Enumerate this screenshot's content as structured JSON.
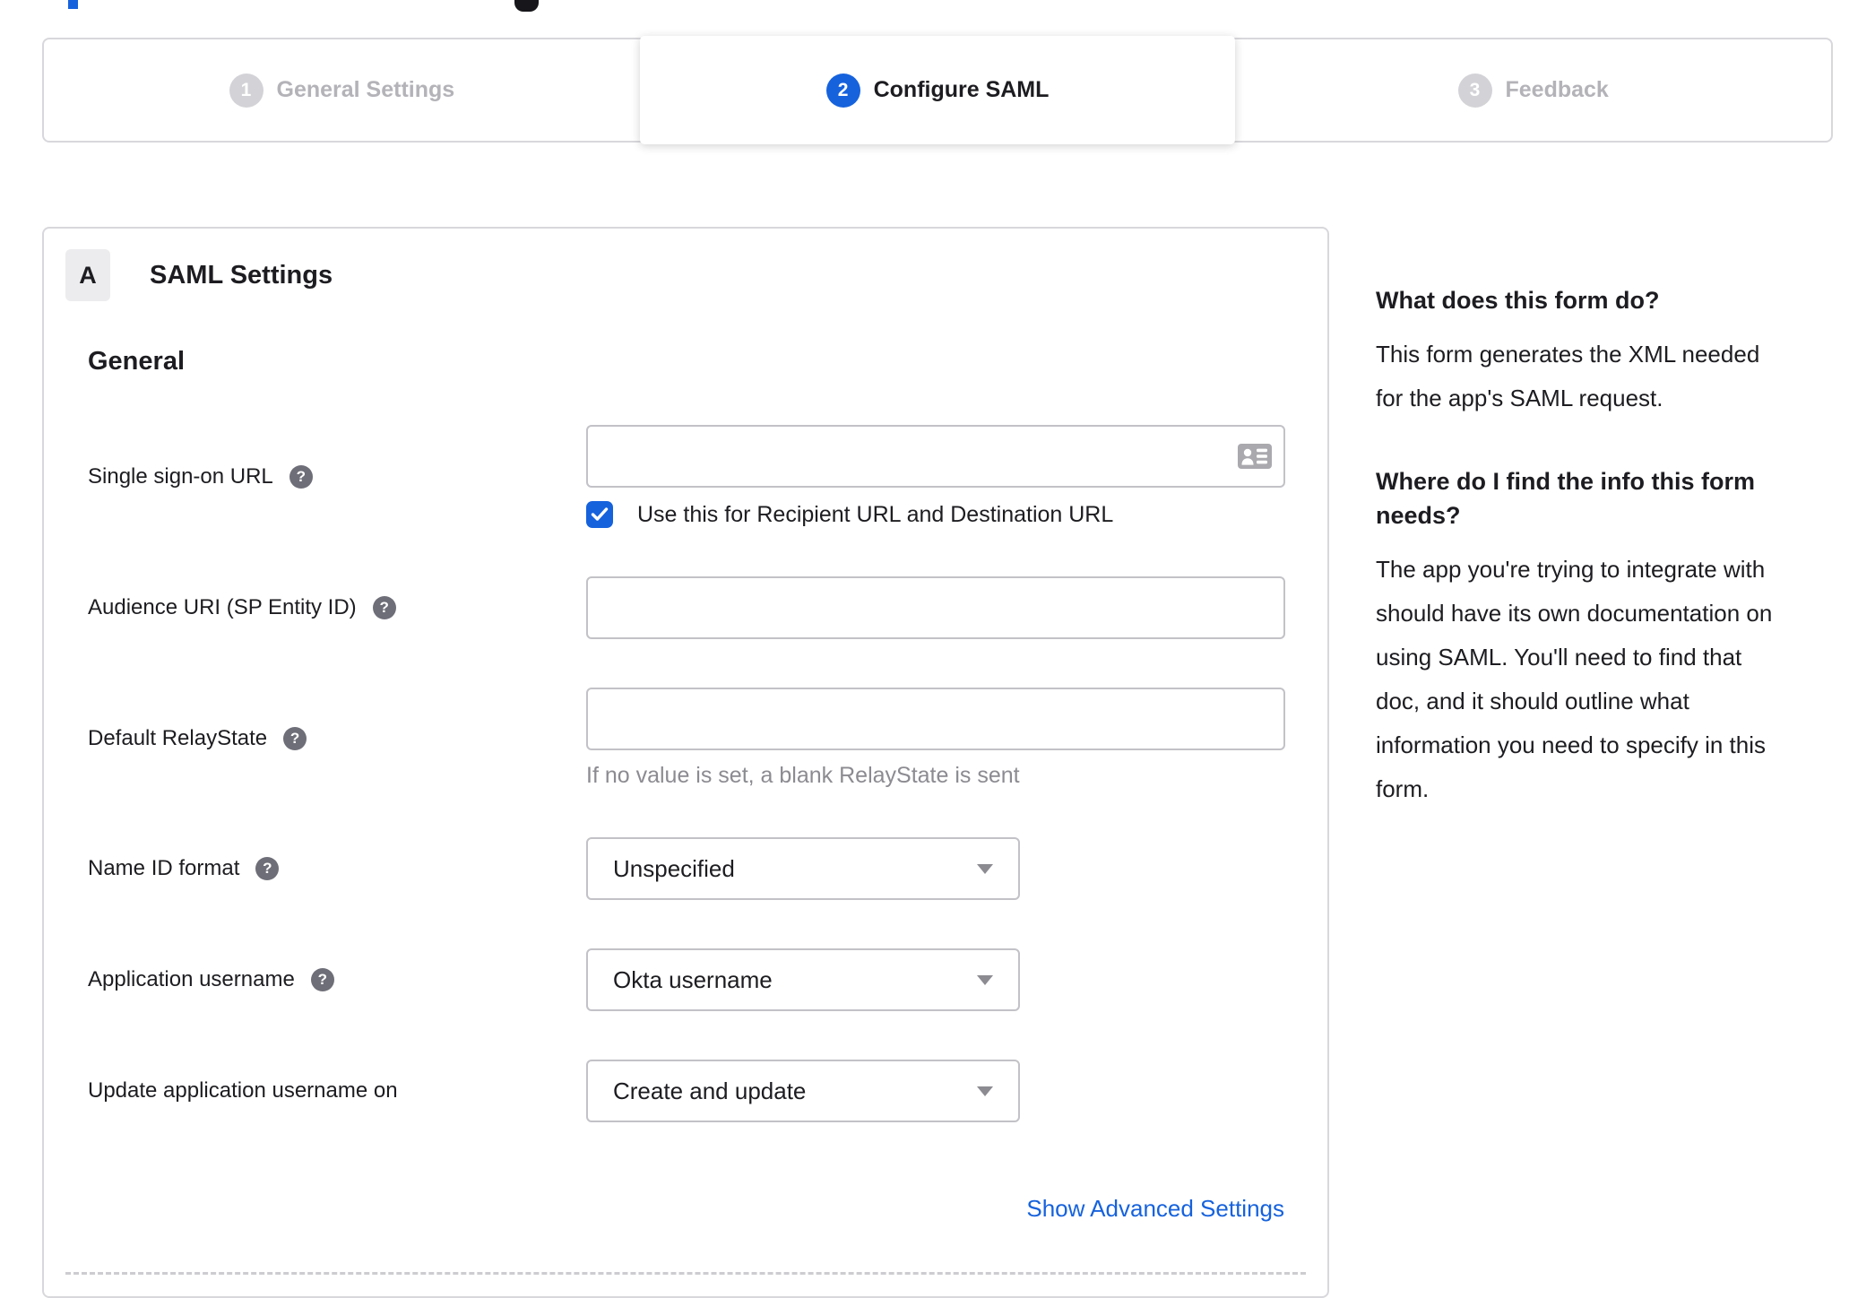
{
  "colors": {
    "accent_blue": "#1662dd",
    "text_dark": "#1d1d21",
    "inactive_gray": "#b3b3b8",
    "border_gray": "#d8d8dc",
    "hint_gray": "#8b8b91"
  },
  "icons": {
    "sso_field_icon": "contact-card-icon",
    "field_help_icon": "question-mark-circle",
    "select_icon": "caret-down",
    "checkbox_icon": "checkmark"
  },
  "stepper": {
    "steps": [
      {
        "number": "1",
        "label": "General Settings",
        "state": "inactive"
      },
      {
        "number": "2",
        "label": "Configure SAML",
        "state": "active"
      },
      {
        "number": "3",
        "label": "Feedback",
        "state": "inactive"
      }
    ]
  },
  "saml_panel": {
    "section_badge": "A",
    "section_title": "SAML Settings",
    "group_heading": "General",
    "rows": [
      {
        "label": "Single sign-on URL",
        "has_help": true,
        "control": "text",
        "value": "",
        "checkbox_label": "Use this for Recipient URL and Destination URL",
        "checkbox_checked": true
      },
      {
        "label": "Audience URI (SP Entity ID)",
        "has_help": true,
        "control": "text",
        "value": ""
      },
      {
        "label": "Default RelayState",
        "has_help": true,
        "control": "text",
        "value": "",
        "hint": "If no value is set, a blank RelayState is sent"
      },
      {
        "label": "Name ID format",
        "has_help": true,
        "control": "select",
        "value": "Unspecified"
      },
      {
        "label": "Application username",
        "has_help": true,
        "control": "select",
        "value": "Okta username"
      },
      {
        "label": "Update application username on",
        "has_help": false,
        "control": "select",
        "value": "Create and update"
      }
    ],
    "advanced_settings_link": "Show Advanced Settings"
  },
  "help_panel": {
    "sections": [
      {
        "title": "What does this form do?",
        "body": "This form generates the XML needed\nfor the app's SAML request."
      },
      {
        "title": "Where do I find the info this form\nneeds?",
        "body": "The app you're trying to integrate with\nshould have its own documentation on\nusing SAML. You'll need to find that\ndoc, and it should outline what\ninformation you need to specify in this\nform."
      }
    ]
  }
}
